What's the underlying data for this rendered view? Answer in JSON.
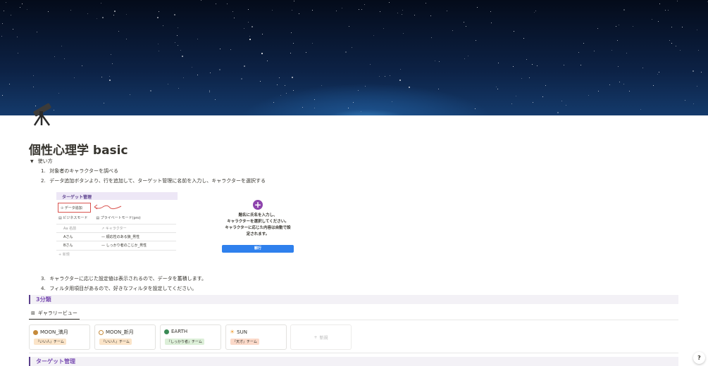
{
  "page": {
    "title": "個性心理学 basic",
    "icon": "telescope-icon"
  },
  "toggle": {
    "label": "使い方"
  },
  "steps": [
    {
      "num": "1.",
      "text": "対象者のキャラクターを調べる"
    },
    {
      "num": "2.",
      "text": "データ追加ボタンより、行を追加して、ターゲット管理に名前を入力し、キャラクターを選択する"
    },
    {
      "num": "3.",
      "text": "キャラクターに応じた設定値は表示されるので、データを蓄積します。"
    },
    {
      "num": "4.",
      "text": "フィルタ用項目があるので、好きなフィルタを設定してください。"
    }
  ],
  "screenshot1": {
    "header": "ターゲット管理",
    "add_button": "データ追加",
    "tab_business": "ビジネスモード",
    "tab_private": "プライベートモード(pro)",
    "col_name": "名前",
    "col_character": "キャラクター",
    "rows": [
      {
        "name": "Aさん",
        "character": "順応性のある狼_男性"
      },
      {
        "name": "Bさん",
        "character": "しっかり者のこじか_男性"
      }
    ],
    "new_label": "新規"
  },
  "screenshot2": {
    "line1": "題名に氏名を入力し、",
    "line2": "キャラクターを選択してください。",
    "line3": "キャラクターに応じた内容は自動で設",
    "line4": "定されます。",
    "button": "観行"
  },
  "section_3": "3分類",
  "view_tab": "ギャラリービュー",
  "cards": [
    {
      "title": "MOON_満月",
      "tag": "『いい人』チーム",
      "dot": "#c58a3a",
      "tagbg": "#fbe4c8"
    },
    {
      "title": "MOON_新月",
      "tag": "『いい人』チーム",
      "dot": "#ffffff",
      "tagbg": "#fbe4c8"
    },
    {
      "title": "EARTH",
      "tag": "『しっかり者』チーム",
      "dot": "#3a8a55",
      "tagbg": "#dcefd8"
    },
    {
      "title": "SUN",
      "tag": "『天才』チーム",
      "dot": "#f2a23c",
      "tagbg": "#fbd9c9"
    }
  ],
  "new_card": "新規",
  "section_target": "ターゲット管理",
  "help": "?"
}
